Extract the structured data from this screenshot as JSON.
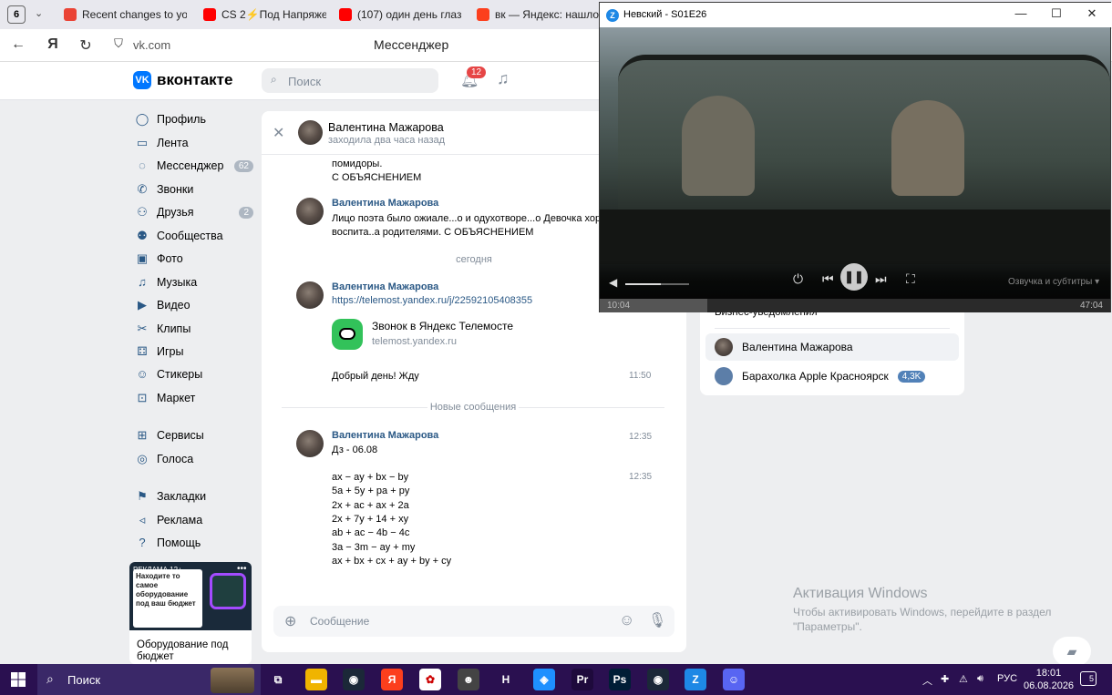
{
  "browser": {
    "tab_count": "6",
    "tabs": [
      {
        "label": "Recent changes to your",
        "color": "#ea4335",
        "icon": "gmail-icon"
      },
      {
        "label": "CS 2⚡Под Напряжен",
        "color": "#ff0000",
        "icon": "youtube-icon"
      },
      {
        "label": "(107) один день глаза",
        "color": "#ff0000",
        "icon": "youtube-icon"
      },
      {
        "label": "вк — Яндекс: нашлось",
        "color": "#fc3f1d",
        "icon": "yandex-icon"
      }
    ],
    "url": "vk.com",
    "page_title": "Мессенджер"
  },
  "vk": {
    "logo": "вконтакте",
    "search_placeholder": "Поиск",
    "notifications": "12",
    "sidebar": [
      {
        "label": "Профиль",
        "icon": "profile-icon",
        "glyph": "◯",
        "badge": ""
      },
      {
        "label": "Лента",
        "icon": "feed-icon",
        "glyph": "▭",
        "badge": ""
      },
      {
        "label": "Мессенджер",
        "icon": "messenger-icon",
        "glyph": "◌",
        "badge": "62"
      },
      {
        "label": "Звонки",
        "icon": "phone-icon",
        "glyph": "✆",
        "badge": ""
      },
      {
        "label": "Друзья",
        "icon": "friends-icon",
        "glyph": "⚇",
        "badge": "2"
      },
      {
        "label": "Сообщества",
        "icon": "communities-icon",
        "glyph": "⚉",
        "badge": ""
      },
      {
        "label": "Фото",
        "icon": "photo-icon",
        "glyph": "▣",
        "badge": ""
      },
      {
        "label": "Музыка",
        "icon": "music-icon",
        "glyph": "♫",
        "badge": ""
      },
      {
        "label": "Видео",
        "icon": "video-icon",
        "glyph": "▶",
        "badge": ""
      },
      {
        "label": "Клипы",
        "icon": "clips-icon",
        "glyph": "✂",
        "badge": ""
      },
      {
        "label": "Игры",
        "icon": "games-icon",
        "glyph": "⚃",
        "badge": ""
      },
      {
        "label": "Стикеры",
        "icon": "stickers-icon",
        "glyph": "☺",
        "badge": ""
      },
      {
        "label": "Маркет",
        "icon": "market-icon",
        "glyph": "⊡",
        "badge": ""
      },
      {
        "label": "Сервисы",
        "icon": "services-icon",
        "glyph": "⊞",
        "badge": ""
      },
      {
        "label": "Голоса",
        "icon": "votes-icon",
        "glyph": "◎",
        "badge": ""
      },
      {
        "label": "Закладки",
        "icon": "bookmark-icon",
        "glyph": "⚑",
        "badge": ""
      },
      {
        "label": "Реклама",
        "icon": "ads-icon",
        "glyph": "◃",
        "badge": ""
      },
      {
        "label": "Помощь",
        "icon": "help-icon",
        "glyph": "?",
        "badge": ""
      }
    ],
    "ad": {
      "tag": "РЕКЛАМА 12+",
      "card_text": "Находите то самое оборудование под ваш бюджет",
      "title": "Оборудование под бюджет"
    }
  },
  "chat": {
    "contact_name": "Валентина Мажарова",
    "contact_status": "заходила два часа назад",
    "top_text_1": "помидоры.",
    "top_text_2": "С ОБЪЯСНЕНИЕМ",
    "msg1_author": "Валентина Мажарова",
    "msg1_text_1": "Лицо поэта было ожиале...о и одухотворе...о Девочка хоро",
    "msg1_text_2": "воспита..а родителями.  С ОБЪЯСНЕНИЕМ",
    "sep_today": "сегодня",
    "msg2_author": "Валентина Мажарова",
    "msg2_link": "https://telemost.yandex.ru/j/22592105408355",
    "msg2_card_title": "Звонок в Яндекс Телемосте",
    "msg2_card_domain": "telemost.yandex.ru",
    "msg3_text": "Добрый день! Жду",
    "msg3_time": "11:50",
    "sep_new": "Новые сообщения",
    "msg4_author": "Валентина Мажарова",
    "msg4_time": "12:35",
    "msg4_text": "Дз - 06.08",
    "msg5_time": "12:35",
    "msg5_lines": [
      "ax − ay + bx − by",
      "5a + 5y + pa + py",
      "2x + ac + ax + 2a",
      "2x + 7y + 14 + xy",
      "ab + ac − 4b − 4c",
      "3a − 3m − ay + my",
      "ax + bx + cx + ay + by + cy"
    ],
    "composer_placeholder": "Сообщение"
  },
  "right_panel": {
    "header": "Бизнес-уведомления",
    "items": [
      {
        "label": "Валентина Мажарова",
        "badge": ""
      },
      {
        "label": "Барахолка Apple Красноярск",
        "badge": "4,3K"
      }
    ]
  },
  "windows_activation": {
    "title": "Активация Windows",
    "text_1": "Чтобы активировать Windows, перейдите в раздел",
    "text_2": "\"Параметры\"."
  },
  "player": {
    "title": "Невский - S01E26",
    "audio_label": "Озвучка и субтитры",
    "time_current": "10:04",
    "time_total": "47:04",
    "progress": 0.21,
    "volume": 0.55
  },
  "taskbar": {
    "search_label": "Поиск",
    "apps": [
      {
        "icon": "taskview-icon",
        "glyph": "⧉",
        "color": "#2a1050"
      },
      {
        "icon": "explorer-icon",
        "glyph": "▬",
        "color": "#f0b400"
      },
      {
        "icon": "steam-icon",
        "glyph": "◉",
        "color": "#1b2838"
      },
      {
        "icon": "yandex-browser-icon",
        "glyph": "Я",
        "color": "#fc3f1d"
      },
      {
        "icon": "photo-app-icon",
        "glyph": "✿",
        "color": "#ffffff"
      },
      {
        "icon": "game-icon",
        "glyph": "☻",
        "color": "#444444"
      },
      {
        "icon": "launcher-icon",
        "glyph": "H",
        "color": "#2a1050"
      },
      {
        "icon": "vpn-icon",
        "glyph": "◈",
        "color": "#1e90ff"
      },
      {
        "icon": "premiere-icon",
        "glyph": "Pr",
        "color": "#1e0a3c"
      },
      {
        "icon": "photoshop-icon",
        "glyph": "Ps",
        "color": "#001e36"
      },
      {
        "icon": "steam-icon-2",
        "glyph": "◉",
        "color": "#1b2838"
      },
      {
        "icon": "player-app-icon",
        "glyph": "Z",
        "color": "#1e88e5"
      },
      {
        "icon": "discord-icon",
        "glyph": "☺",
        "color": "#5865f2"
      }
    ],
    "lang": "РУС",
    "time": "18:01",
    "date": "06.08.2026",
    "notif_count": "5"
  }
}
